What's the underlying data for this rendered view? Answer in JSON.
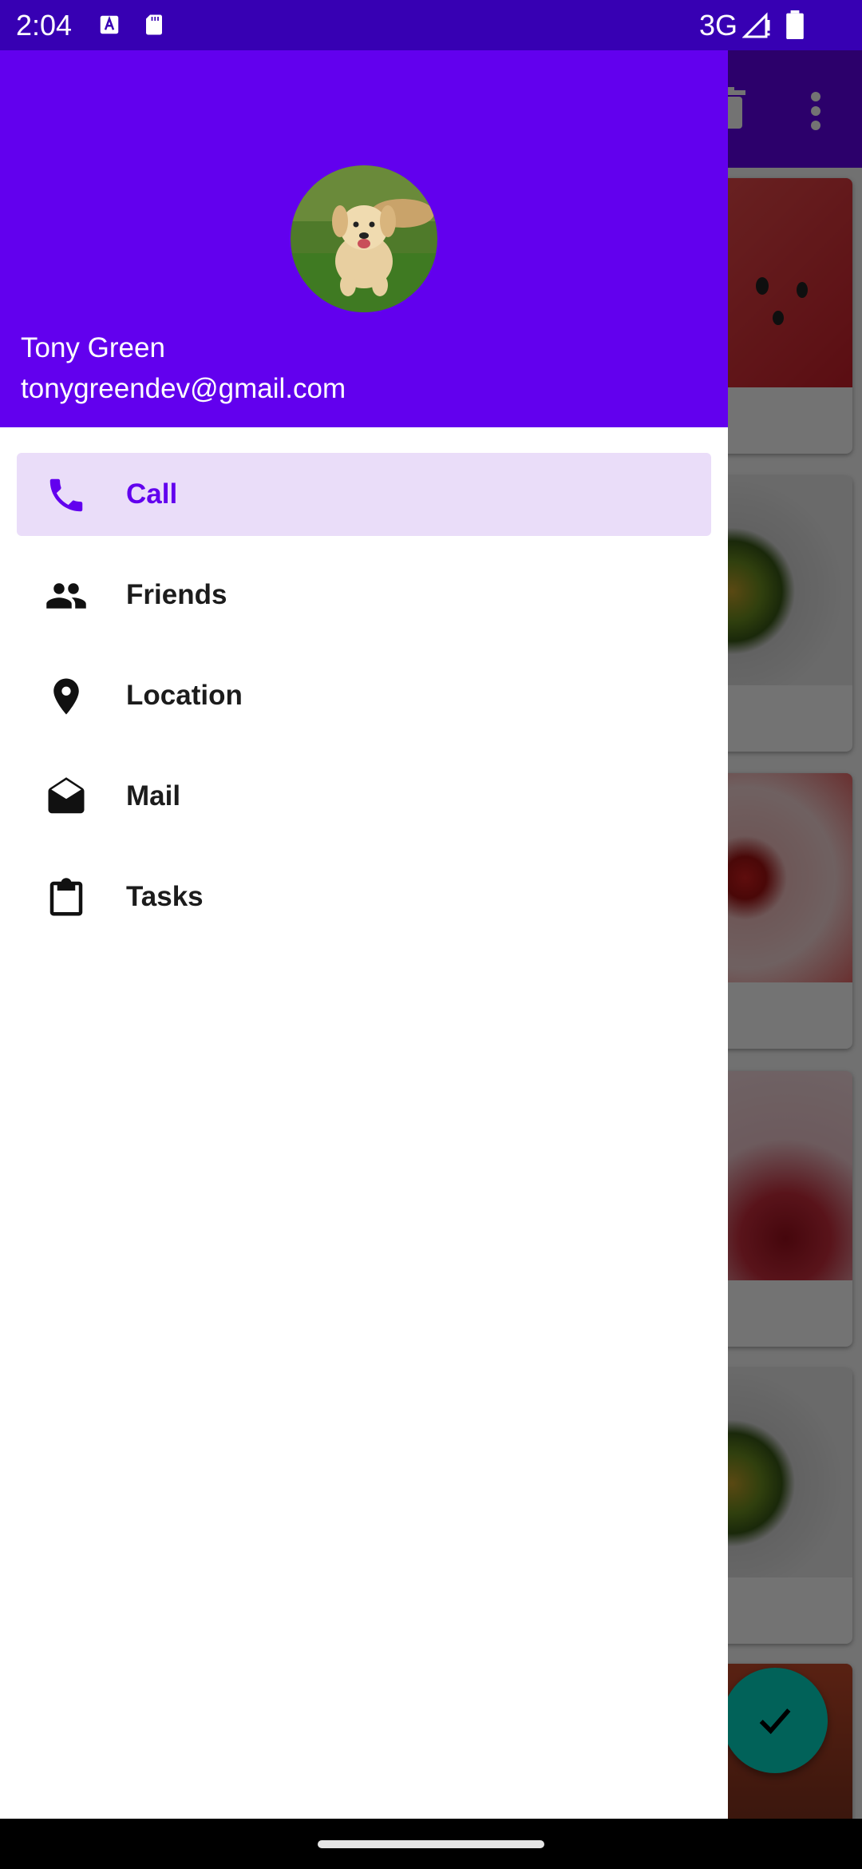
{
  "status_bar": {
    "time": "2:04",
    "network": "3G",
    "icons": [
      "app-a-icon",
      "sd-card-icon",
      "signal-icon",
      "battery-icon"
    ]
  },
  "drawer": {
    "header": {
      "name": "Tony Green",
      "email": "tonygreendev@gmail.com",
      "avatar": "puppy-avatar-icon"
    },
    "items": [
      {
        "label": "Call",
        "icon": "phone-icon",
        "selected": true
      },
      {
        "label": "Friends",
        "icon": "people-icon",
        "selected": false
      },
      {
        "label": "Location",
        "icon": "location-pin-icon",
        "selected": false
      },
      {
        "label": "Mail",
        "icon": "mail-open-icon",
        "selected": false
      },
      {
        "label": "Tasks",
        "icon": "clipboard-icon",
        "selected": false
      }
    ]
  },
  "background_app": {
    "toolbar_actions": [
      "delete-icon",
      "more-vert-icon"
    ],
    "fab_icon": "check-icon"
  },
  "colors": {
    "primary": "#6200EE",
    "primary_dark": "#3700B3",
    "secondary": "#03DAC5",
    "selected_bg": "#EADDF9"
  }
}
